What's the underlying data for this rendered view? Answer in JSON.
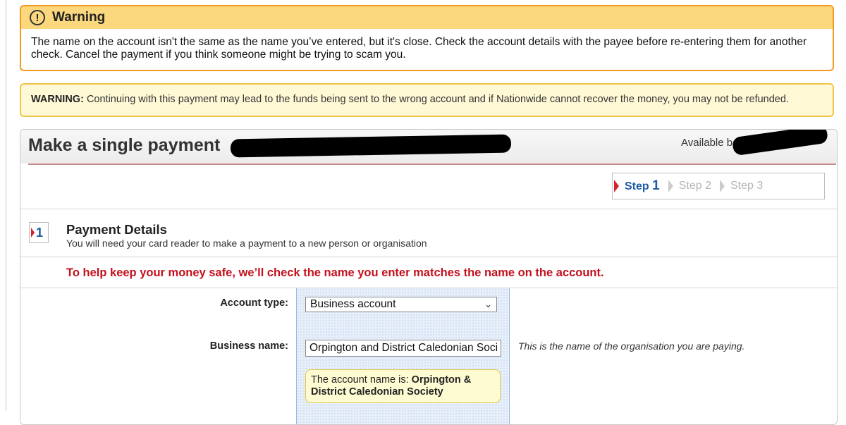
{
  "warning_box": {
    "title": "Warning",
    "icon": "exclamation-circle-icon",
    "body": "The name on the account isn't the same as the name you’ve entered, but it's close. Check the account details with the payee before re-entering them for another check. Cancel the payment if you think someone might be trying to scam you."
  },
  "risk_notice": {
    "label": "WARNING:",
    "text": " Continuing with this payment may lead to the funds being sent to the wrong account and if Nationwide cannot recover the money, you may not be refunded."
  },
  "panel": {
    "title": "Make a single payment",
    "available_label": "Available ba"
  },
  "steps": [
    {
      "label": "Step",
      "num": "1",
      "active": true
    },
    {
      "label": "Step 2",
      "active": false
    },
    {
      "label": "Step 3",
      "active": false
    }
  ],
  "section": {
    "number": "1",
    "title": "Payment Details",
    "subtitle": "You will need your card reader to make a payment to a new person or organisation"
  },
  "safety_notice": "To help keep your money safe, we’ll check the name you enter matches the name on the account.",
  "form": {
    "account_type_label": "Account type:",
    "account_type_value": "Business account",
    "business_name_label": "Business name:",
    "business_name_value": "Orpington and District Caledonian Soci",
    "business_name_hint": "This is the name of the organisation you are paying.",
    "name_check_prefix": "The account name is: ",
    "name_check_value": "Orpington & District Caledonian Society"
  },
  "colors": {
    "warning_border": "#f29a1e",
    "warning_header": "#fbd77e",
    "notice_red": "#c4101c",
    "step_active": "#1f5aa6"
  }
}
